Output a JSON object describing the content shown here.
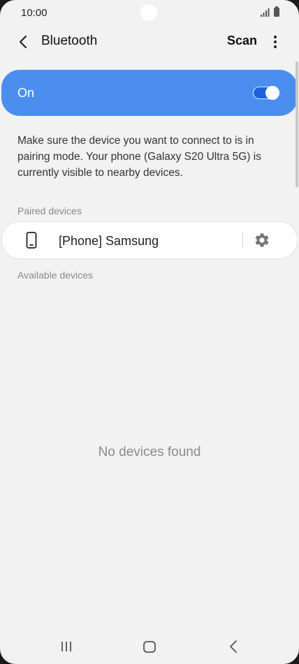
{
  "status_bar": {
    "time": "10:00",
    "icons": [
      "signal-icon",
      "battery-icon"
    ]
  },
  "header": {
    "back_icon": "chevron-left-icon",
    "title": "Bluetooth",
    "scan_label": "Scan",
    "more_icon": "more-vertical-icon"
  },
  "toggle": {
    "label": "On",
    "state": "on",
    "accent_color": "#4a8ff0"
  },
  "description": "Make sure the device you want to connect to is in pairing mode. Your phone (Galaxy S20 Ultra 5G) is currently visible to nearby devices.",
  "paired": {
    "header": "Paired devices",
    "devices": [
      {
        "name": "[Phone] Samsung",
        "icon": "phone-icon",
        "action_icon": "gear-icon"
      }
    ]
  },
  "available": {
    "header": "Available devices",
    "empty_message": "No devices found"
  },
  "nav_bar": {
    "items": [
      "recent-apps-icon",
      "home-icon",
      "back-icon"
    ]
  }
}
